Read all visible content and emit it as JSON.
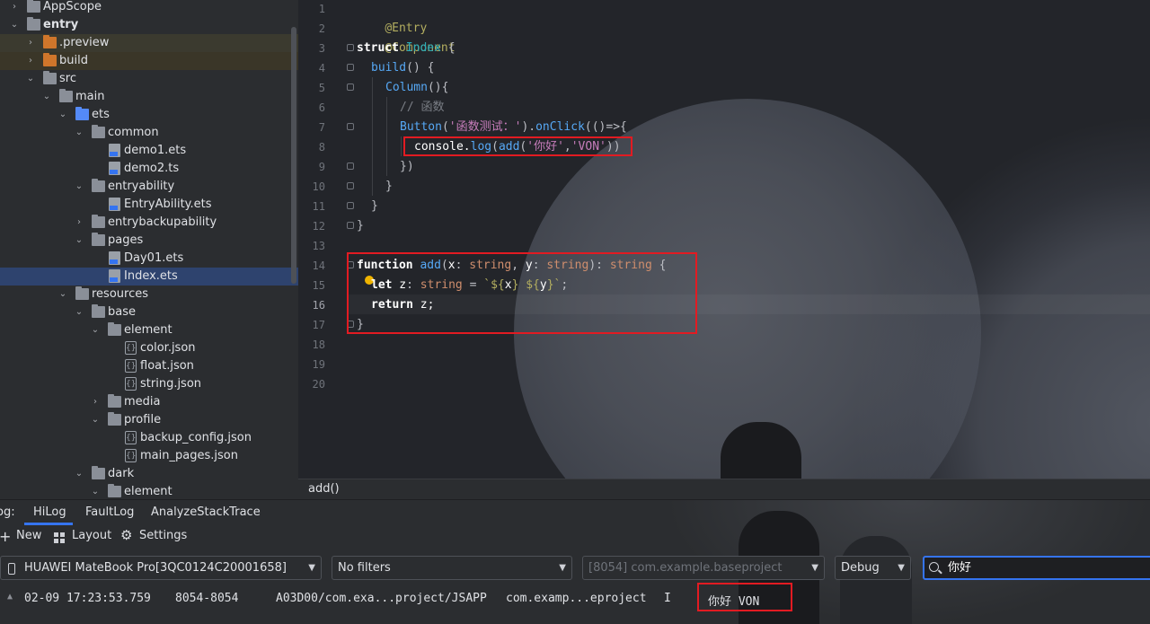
{
  "project_tree": {
    "items": [
      {
        "label": "AppScope",
        "arrow": "›"
      },
      {
        "label": "entry",
        "arrow": "⌄"
      },
      {
        "label": ".preview",
        "arrow": "›"
      },
      {
        "label": "build",
        "arrow": "›"
      },
      {
        "label": "src",
        "arrow": "⌄"
      },
      {
        "label": "main",
        "arrow": "⌄"
      },
      {
        "label": "ets",
        "arrow": "⌄"
      },
      {
        "label": "common",
        "arrow": "⌄"
      },
      {
        "label": "demo1.ets"
      },
      {
        "label": "demo2.ts"
      },
      {
        "label": "entryability",
        "arrow": "⌄"
      },
      {
        "label": "EntryAbility.ets"
      },
      {
        "label": "entrybackupability",
        "arrow": "›"
      },
      {
        "label": "pages",
        "arrow": "⌄"
      },
      {
        "label": "Day01.ets"
      },
      {
        "label": "Index.ets"
      },
      {
        "label": "resources",
        "arrow": "⌄"
      },
      {
        "label": "base",
        "arrow": "⌄"
      },
      {
        "label": "element",
        "arrow": "⌄"
      },
      {
        "label": "color.json"
      },
      {
        "label": "float.json"
      },
      {
        "label": "string.json"
      },
      {
        "label": "media",
        "arrow": "›"
      },
      {
        "label": "profile",
        "arrow": "⌄"
      },
      {
        "label": "backup_config.json"
      },
      {
        "label": "main_pages.json"
      },
      {
        "label": "dark",
        "arrow": "⌄"
      },
      {
        "label": "element",
        "arrow": "⌄"
      }
    ]
  },
  "editor": {
    "line_numbers": [
      "1",
      "2",
      "3",
      "4",
      "5",
      "6",
      "7",
      "8",
      "9",
      "10",
      "11",
      "12",
      "13",
      "14",
      "15",
      "16",
      "17",
      "18",
      "19",
      "20"
    ],
    "code": {
      "l1": "@Entry",
      "l2": "@Component",
      "l3_kw": "struct",
      "l3_name": "Index",
      "l3_brace": "{",
      "l4_fn": "build",
      "l4_rest": "() {",
      "l5_fn": "Column",
      "l5_rest": "(){",
      "l6": "// 函数",
      "l7_fn": "Button",
      "l7_p1": "(",
      "l7_str": "'函数测试：'",
      "l7_p2": ").",
      "l7_fn2": "onClick",
      "l7_rest": "(()=>{",
      "l8_obj": "console.",
      "l8_fn": "log",
      "l8_p1": "(",
      "l8_fn2": "add",
      "l8_p2": "(",
      "l8_s1": "'你好'",
      "l8_c": ",",
      "l8_s2": "'VON'",
      "l8_p3": "))",
      "l9": "})",
      "l10": "}",
      "l11": "}",
      "l12": "}",
      "l14_kw": "function",
      "l14_fn": "add",
      "l14_p1": "(",
      "l14_x": "x",
      "l14_c1": ": ",
      "l14_t1": "string",
      "l14_c2": ", ",
      "l14_y": "y",
      "l14_c3": ": ",
      "l14_t2": "string",
      "l14_c4": "): ",
      "l14_t3": "string",
      "l14_b": " {",
      "l15_kw": "let",
      "l15_var": " z",
      "l15_c": ": ",
      "l15_t": "string",
      "l15_eq": " = ",
      "l15_tpl1": "`${",
      "l15_x": "x",
      "l15_tpl2": "} ${",
      "l15_y": "y",
      "l15_tpl3": "}`",
      "l15_semi": ";",
      "l16_kw": "return",
      "l16_rest": " z;",
      "l17": "}"
    },
    "breadcrumb": "add()"
  },
  "log_panel": {
    "tab_prefix": "og:",
    "tabs": [
      "HiLog",
      "FaultLog",
      "AnalyzeStackTrace"
    ],
    "toolbar": {
      "new": "New",
      "layout": "Layout",
      "settings": "Settings"
    },
    "device": "HUAWEI MateBook Pro[3QC0124C20001658]",
    "filter": "No filters",
    "process": "[8054] com.example.baseproject",
    "level": "Debug",
    "search": "你好",
    "entry": {
      "time": "02-09 17:23:53.759",
      "pid": "8054-8054",
      "tag": "A03D00/com.exa...project/JSAPP",
      "package": "com.examp...eproject",
      "level": "I",
      "message": "你好 VON"
    }
  },
  "colors": {
    "accent": "#3574f0",
    "highlight_box": "#e21b22"
  }
}
